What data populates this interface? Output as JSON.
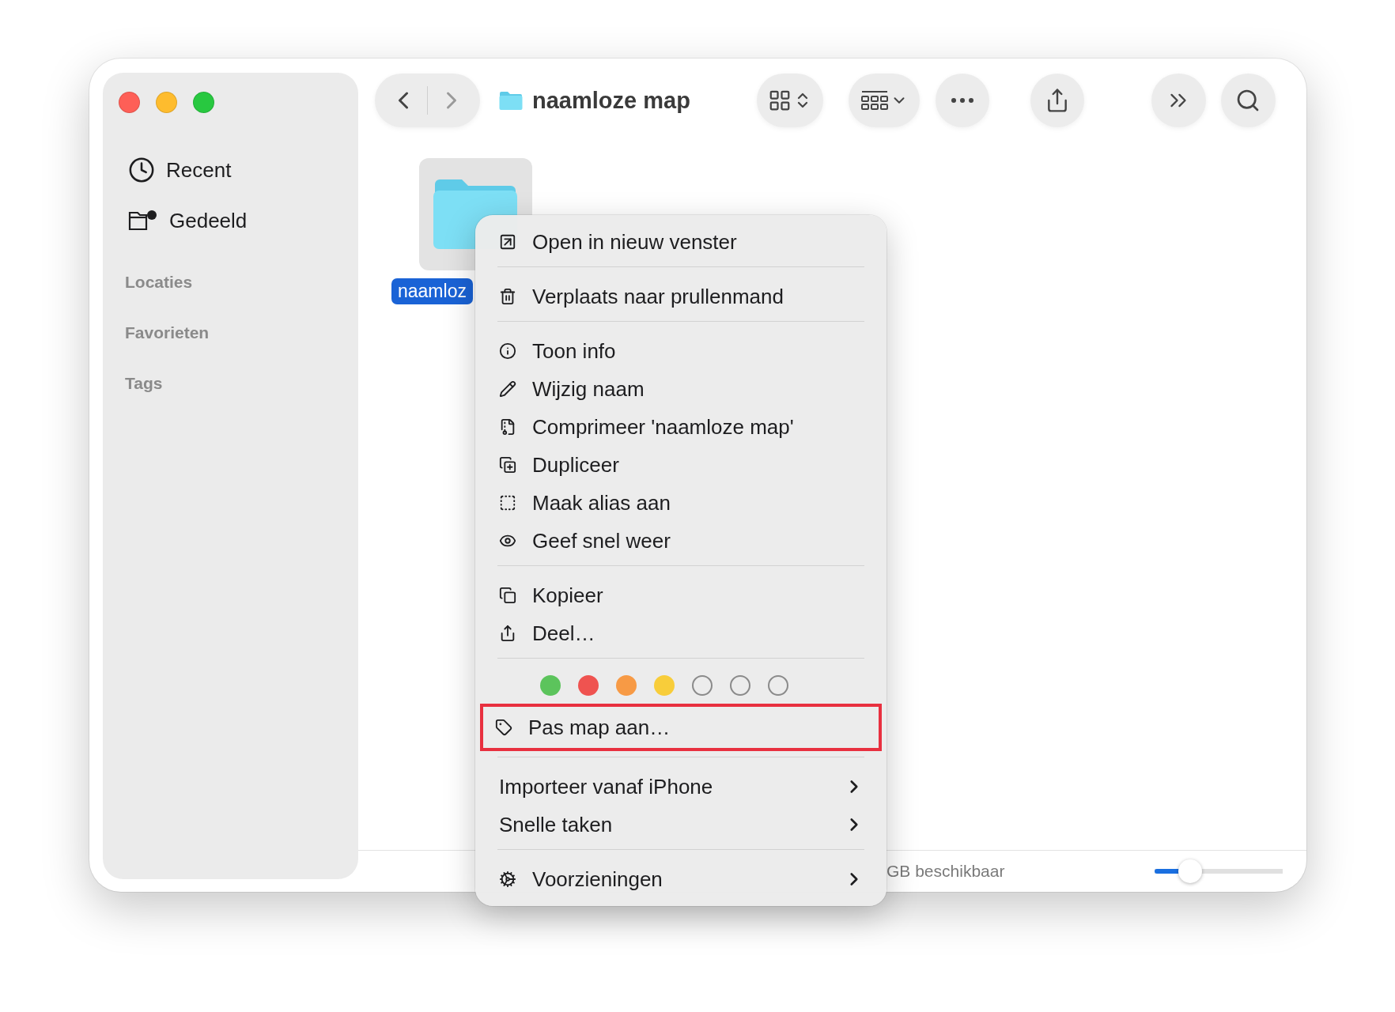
{
  "window": {
    "title": "naamloze map"
  },
  "sidebar": {
    "items": [
      {
        "label": "Recent",
        "selected": false
      },
      {
        "label": "Gedeeld",
        "selected": false
      }
    ],
    "sections": [
      "Locaties",
      "Favorieten",
      "Tags"
    ]
  },
  "content": {
    "items": [
      {
        "name": "naamloz",
        "selected": true
      }
    ]
  },
  "context_menu": {
    "sections": [
      {
        "items": [
          {
            "label": "Open in nieuw venster",
            "submenu": false,
            "highlighted": false
          }
        ]
      },
      {
        "items": [
          {
            "label": "Verplaats naar prullenmand",
            "submenu": false,
            "highlighted": false
          }
        ]
      },
      {
        "items": [
          {
            "label": "Toon info",
            "submenu": false,
            "highlighted": false
          },
          {
            "label": "Wijzig naam",
            "submenu": false,
            "highlighted": false
          },
          {
            "label": "Comprimeer 'naamloze map'",
            "submenu": false,
            "highlighted": false
          },
          {
            "label": "Dupliceer",
            "submenu": false,
            "highlighted": false
          },
          {
            "label": "Maak alias aan",
            "submenu": false,
            "highlighted": false
          },
          {
            "label": "Geef snel weer",
            "submenu": false,
            "highlighted": false
          }
        ]
      },
      {
        "items": [
          {
            "label": "Kopieer",
            "submenu": false,
            "highlighted": false
          },
          {
            "label": "Deel…",
            "submenu": false,
            "highlighted": false
          }
        ]
      },
      {
        "tags": [
          {
            "kind": "filled",
            "color": "#5cc45c"
          },
          {
            "kind": "filled",
            "color": "#ef5350"
          },
          {
            "kind": "filled",
            "color": "#f79a45"
          },
          {
            "kind": "filled",
            "color": "#f8cd3a"
          },
          {
            "kind": "empty"
          },
          {
            "kind": "empty"
          },
          {
            "kind": "empty"
          }
        ],
        "items": [
          {
            "label": "Pas map aan…",
            "submenu": false,
            "highlighted": true
          }
        ]
      },
      {
        "items": [
          {
            "label": "Importeer vanaf iPhone",
            "submenu": true,
            "highlighted": false
          },
          {
            "label": "Snelle taken",
            "submenu": true,
            "highlighted": false
          }
        ]
      },
      {
        "items": [
          {
            "label": "Voorzieningen",
            "submenu": true,
            "highlighted": false
          }
        ]
      }
    ]
  },
  "status_bar": {
    "text": "GB beschikbaar",
    "zoom": {
      "level": 0.28
    }
  }
}
